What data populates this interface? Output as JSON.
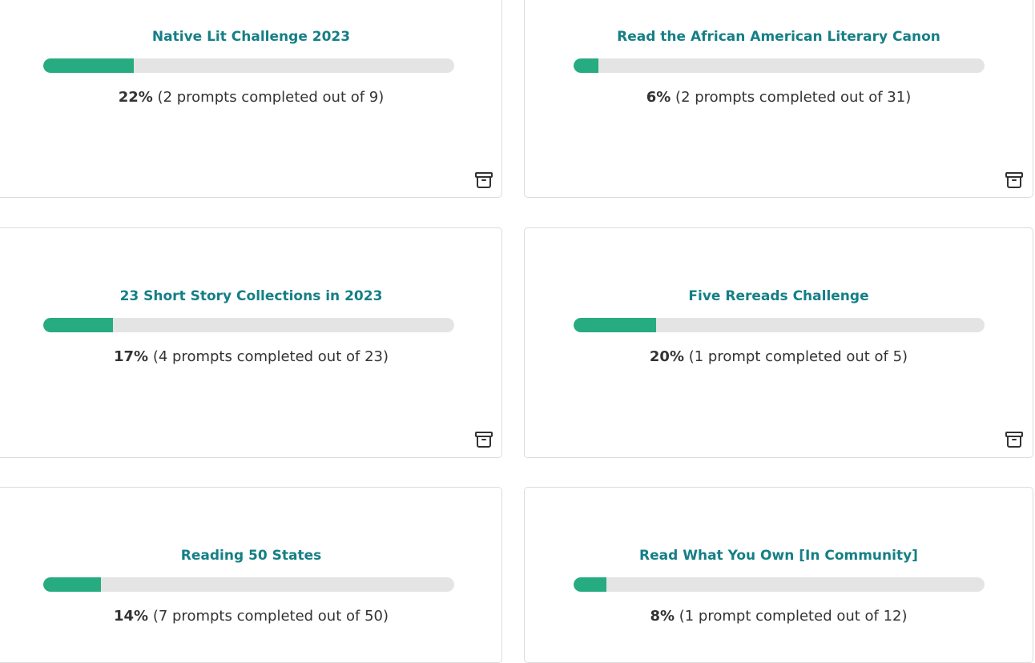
{
  "cards": [
    {
      "title": "Native Lit Challenge 2023",
      "percent_label": "22%",
      "detail": "(2 prompts completed out of 9)",
      "progress": 0.22
    },
    {
      "title": "Read the African American Literary Canon",
      "percent_label": "6%",
      "detail": "(2 prompts completed out of 31)",
      "progress": 0.06
    },
    {
      "title": "23 Short Story Collections in 2023",
      "percent_label": "17%",
      "detail": "(4 prompts completed out of 23)",
      "progress": 0.17
    },
    {
      "title": "Five Rereads Challenge",
      "percent_label": "20%",
      "detail": "(1 prompt completed out of 5)",
      "progress": 0.2
    },
    {
      "title": "Reading 50 States",
      "percent_label": "14%",
      "detail": "(7 prompts completed out of 50)",
      "progress": 0.14
    },
    {
      "title": "Read What You Own [In Community]",
      "percent_label": "8%",
      "detail": "(1 prompt completed out of 12)",
      "progress": 0.08
    }
  ],
  "icons": {
    "archive": "archive-icon"
  },
  "colors": {
    "title": "#157f86",
    "bar_fill": "#27ab80",
    "bar_track": "#e4e4e4",
    "text": "#333333"
  }
}
